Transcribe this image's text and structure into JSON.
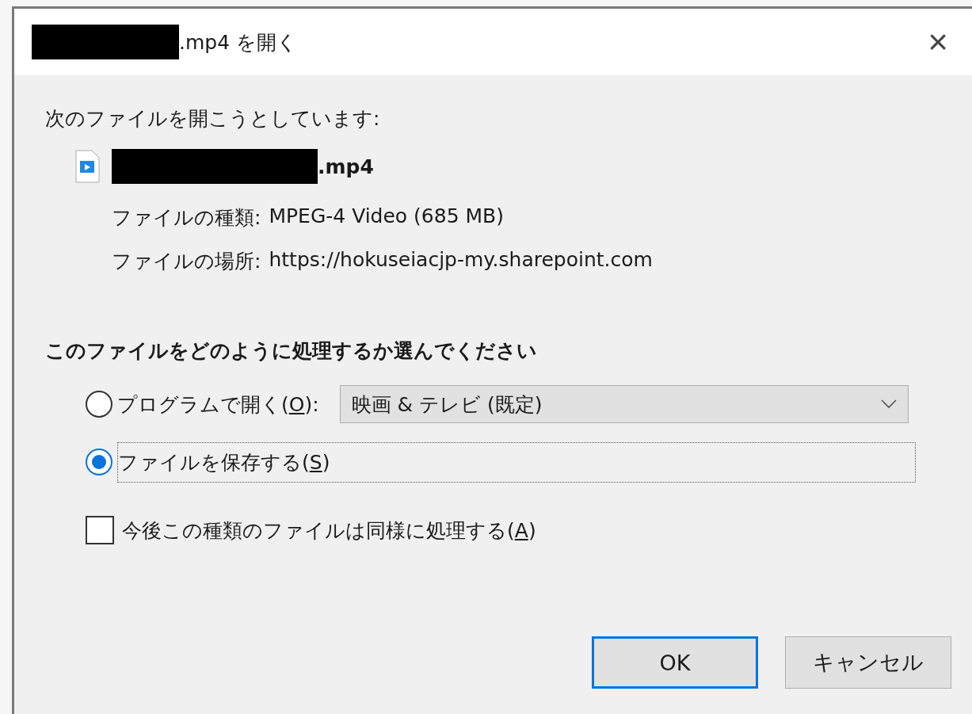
{
  "window": {
    "title_end": ".mp4 を開く",
    "close": "×"
  },
  "intro": "次のファイルを開こうとしています:",
  "file": {
    "name_end": ".mp4",
    "details": [
      {
        "label": "ファイルの種類:",
        "value": "MPEG-4 Video (685 MB)"
      },
      {
        "label": "ファイルの場所:",
        "value": "https://hokuseiacjp-my.sharepoint.com"
      }
    ]
  },
  "question": "このファイルをどのように処理するか選んでください",
  "options": [
    {
      "kind": "open",
      "before": "プログラムで開く(",
      "key": "O",
      "after": "):",
      "selected": false,
      "program": "映画 & テレビ (既定)"
    },
    {
      "kind": "save",
      "before": "ファイルを保存する(",
      "key": "S",
      "after": ")",
      "selected": true
    }
  ],
  "remember": {
    "before": "今後この種類のファイルは同様に処理する(",
    "key": "A",
    "after": ")",
    "checked": false
  },
  "buttons": [
    {
      "label": "OK",
      "default": true
    },
    {
      "label": "キャンセル",
      "default": false
    }
  ]
}
